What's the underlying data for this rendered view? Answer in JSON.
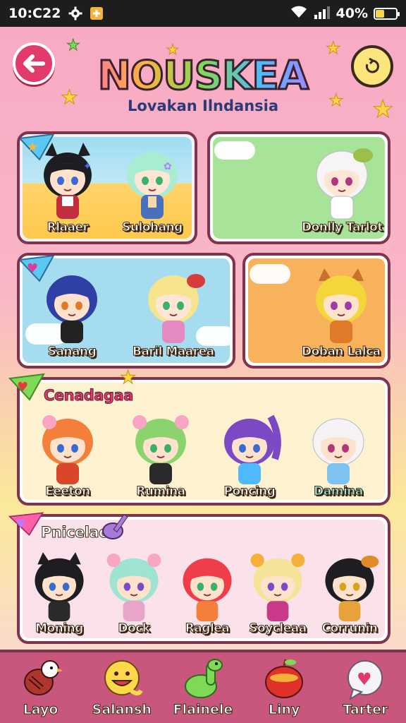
{
  "status": {
    "time": "10:C22",
    "battery": "40%",
    "battery_level": 0.4
  },
  "header": {
    "title": "NOUSKEA",
    "subtitle": "Lovakan Ilndansia"
  },
  "row1": {
    "left": [
      {
        "name": "Rlaaer"
      },
      {
        "name": "Sulohang"
      }
    ],
    "right": [
      {
        "name": "Donlly Tarlot"
      }
    ]
  },
  "row2": {
    "left": [
      {
        "name": "Sanang"
      },
      {
        "name": "Baril Maarea"
      }
    ],
    "right": [
      {
        "name": "Doban Lalca"
      }
    ]
  },
  "section3": {
    "label": "Cenadagaa",
    "characters": [
      {
        "name": "Eeeton"
      },
      {
        "name": "Rumina"
      },
      {
        "name": "Poncing"
      },
      {
        "name": "Damina"
      }
    ]
  },
  "section4": {
    "label": "Pnicelaoi",
    "characters": [
      {
        "name": "Moning"
      },
      {
        "name": "Dock"
      },
      {
        "name": "Raglea"
      },
      {
        "name": "Soycleaa"
      },
      {
        "name": "Corrunin"
      }
    ]
  },
  "nav": [
    {
      "label": "Layo",
      "icon": "bird-icon"
    },
    {
      "label": "Salansh",
      "icon": "smiley-icon"
    },
    {
      "label": "Flainele",
      "icon": "dino-icon"
    },
    {
      "label": "Liny",
      "icon": "apple-icon"
    },
    {
      "label": "Tarter",
      "icon": "chat-heart-icon"
    }
  ],
  "colors": {
    "accent": "#e33a6c",
    "border": "#7d3450",
    "nav_bg": "#c9577d"
  }
}
